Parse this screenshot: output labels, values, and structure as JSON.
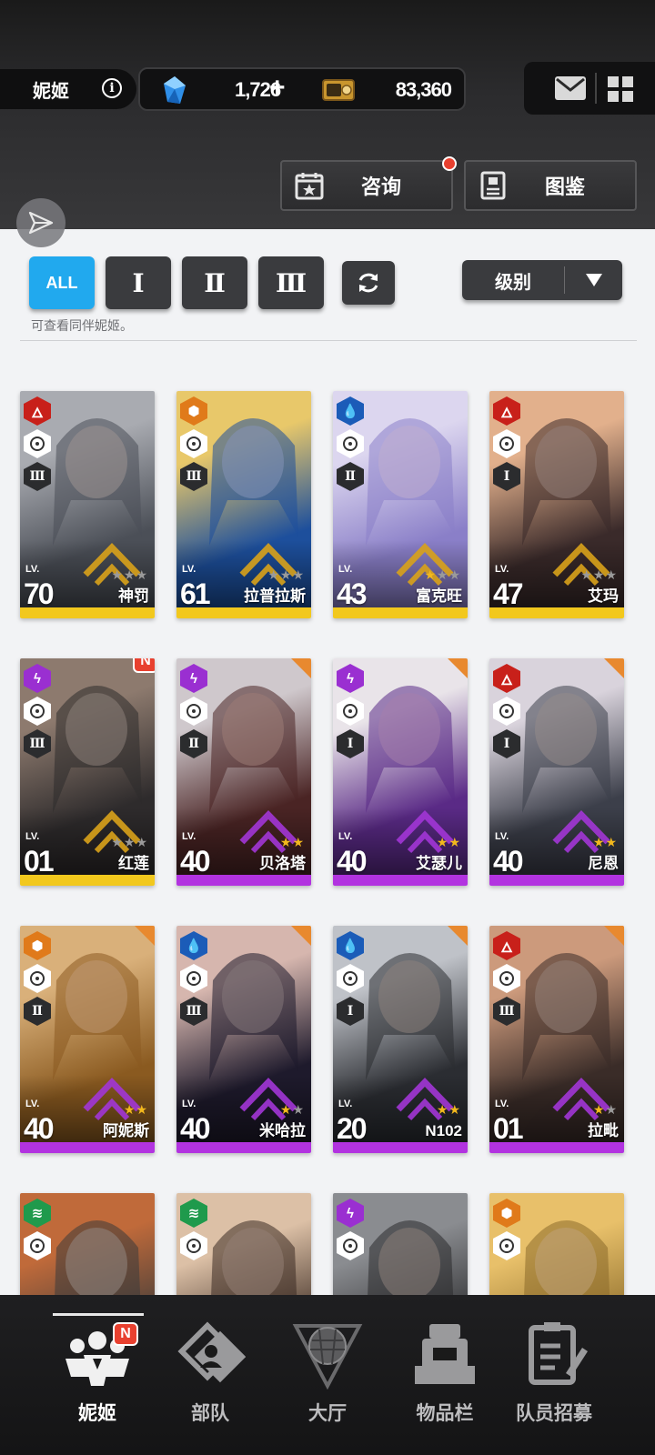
{
  "header": {
    "title": "妮姬",
    "gems": "1,726",
    "gems_plus": "+",
    "credits": "83,360",
    "consult_label": "咨询",
    "gallery_label": "图鉴"
  },
  "filters": {
    "all_label": "ALL",
    "burst1": "Ⅰ",
    "burst2": "Ⅱ",
    "burst3": "Ⅲ",
    "sort_label": "级别",
    "hint": "可查看同伴妮姬。"
  },
  "colors": {
    "fire": "#c8201a",
    "iron": "#e07a1a",
    "water": "#1b5cb8",
    "electric": "#9a2fd1",
    "wind": "#1f9a4c",
    "bar_ssr": "#f2c81d",
    "bar_sr": "#b233e0",
    "accent": "#21a9ee"
  },
  "cards": [
    {
      "name": "神罚",
      "level": "70",
      "element": "fire",
      "burst": "Ⅲ",
      "rarity": "SSR",
      "stars": 0,
      "art": [
        "#4b4f57",
        "#a9abb1"
      ]
    },
    {
      "name": "拉普拉斯",
      "level": "61",
      "element": "iron",
      "burst": "Ⅲ",
      "rarity": "SSR",
      "stars": 0,
      "art": [
        "#1d4f9c",
        "#e8c86a"
      ]
    },
    {
      "name": "富克旺",
      "level": "43",
      "element": "water",
      "burst": "Ⅱ",
      "rarity": "SSR",
      "stars": 1,
      "art": [
        "#8a7fc8",
        "#dcd6ef"
      ]
    },
    {
      "name": "艾玛",
      "level": "47",
      "element": "fire",
      "burst": "Ⅰ",
      "rarity": "SSR",
      "stars": 0,
      "art": [
        "#3a2a2a",
        "#e2b08c"
      ]
    },
    {
      "name": "红莲",
      "level": "01",
      "element": "electric",
      "burst": "Ⅲ",
      "rarity": "SSR",
      "stars": 0,
      "art": [
        "#2e2b2c",
        "#8d7a6e"
      ],
      "is_new": true,
      "new_label": "N"
    },
    {
      "name": "贝洛塔",
      "level": "40",
      "element": "electric",
      "burst": "Ⅱ",
      "rarity": "SR",
      "stars": 2,
      "art": [
        "#4a2424",
        "#cfc8cc"
      ]
    },
    {
      "name": "艾瑟儿",
      "level": "40",
      "element": "electric",
      "burst": "Ⅰ",
      "rarity": "SR",
      "stars": 2,
      "art": [
        "#5a2a86",
        "#e9e4e9"
      ]
    },
    {
      "name": "尼恩",
      "level": "40",
      "element": "fire",
      "burst": "Ⅰ",
      "rarity": "SR",
      "stars": 2,
      "art": [
        "#3c3f4a",
        "#d9d3dc"
      ]
    },
    {
      "name": "阿妮斯",
      "level": "40",
      "element": "iron",
      "burst": "Ⅱ",
      "rarity": "SR",
      "stars": 2,
      "art": [
        "#8a5a20",
        "#d9b07a"
      ]
    },
    {
      "name": "米哈拉",
      "level": "40",
      "element": "water",
      "burst": "Ⅲ",
      "rarity": "SR",
      "stars": 1,
      "art": [
        "#1e1a2c",
        "#d6b6ae"
      ]
    },
    {
      "name": "N102",
      "level": "20",
      "element": "water",
      "burst": "Ⅰ",
      "rarity": "SR",
      "stars": 2,
      "art": [
        "#2b2d32",
        "#bfc2c8"
      ]
    },
    {
      "name": "拉毗",
      "level": "01",
      "element": "fire",
      "burst": "Ⅲ",
      "rarity": "SR",
      "stars": 1,
      "art": [
        "#3a2c28",
        "#cc9a7c"
      ]
    },
    {
      "name": "",
      "level": "",
      "element": "wind",
      "burst": "",
      "rarity": "",
      "stars": 0,
      "art": [
        "#3a3a3a",
        "#c06a3a"
      ]
    },
    {
      "name": "",
      "level": "",
      "element": "wind",
      "burst": "",
      "rarity": "",
      "stars": 0,
      "art": [
        "#3a2a22",
        "#dcc0a6"
      ]
    },
    {
      "name": "",
      "level": "",
      "element": "electric",
      "burst": "",
      "rarity": "",
      "stars": 0,
      "art": [
        "#2a2a2c",
        "#8a8c90"
      ]
    },
    {
      "name": "",
      "level": "",
      "element": "iron",
      "burst": "",
      "rarity": "",
      "stars": 0,
      "art": [
        "#8a6a2a",
        "#e8c06a"
      ]
    }
  ],
  "nav": [
    {
      "label": "妮姬",
      "icon": "nikke-group-icon",
      "active": true,
      "new_label": "N"
    },
    {
      "label": "部队",
      "icon": "squad-icon",
      "active": false
    },
    {
      "label": "大厅",
      "icon": "lobby-icon",
      "active": false
    },
    {
      "label": "物品栏",
      "icon": "inventory-icon",
      "active": false
    },
    {
      "label": "队员招募",
      "icon": "recruit-icon",
      "active": false
    }
  ]
}
